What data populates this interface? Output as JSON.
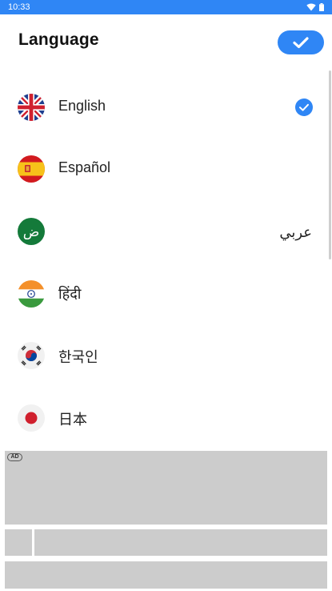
{
  "status_bar": {
    "time": "10:33",
    "icons": [
      "wifi-icon",
      "battery-icon"
    ]
  },
  "header": {
    "title": "Language",
    "confirm_icon": "check-icon"
  },
  "languages": [
    {
      "name": "English",
      "flag": "uk-flag",
      "selected": true
    },
    {
      "name": "Español",
      "flag": "spain-flag",
      "selected": false
    },
    {
      "name": "عربي",
      "flag": "arabic-flag",
      "flag_glyph": "ض",
      "selected": false
    },
    {
      "name": "हिंदी",
      "flag": "india-flag",
      "selected": false
    },
    {
      "name": "한국인",
      "flag": "korea-flag",
      "selected": false
    },
    {
      "name": "日本",
      "flag": "japan-flag",
      "selected": false
    }
  ],
  "ad": {
    "badge": "AD"
  },
  "colors": {
    "accent": "#2f86f5",
    "ad_placeholder": "#cccccc"
  }
}
